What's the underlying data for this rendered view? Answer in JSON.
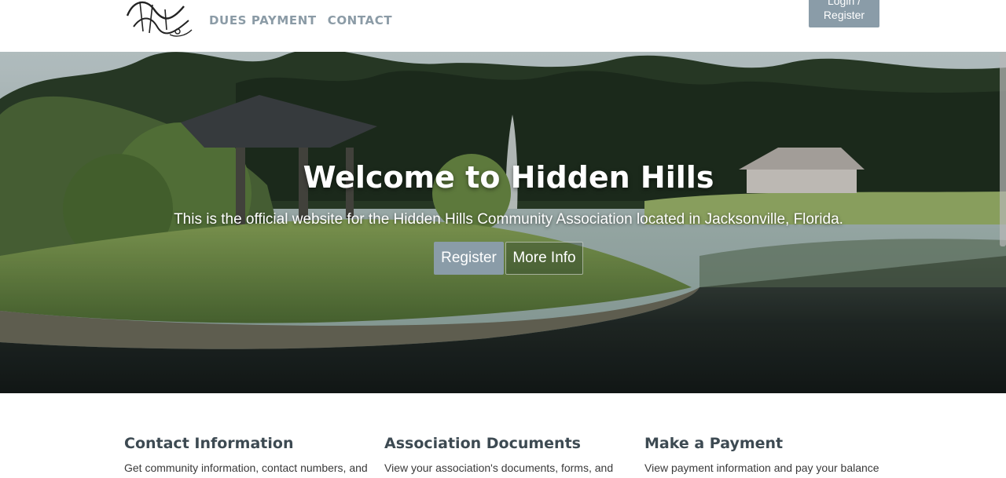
{
  "header": {
    "logo_alt": "Hidden Hills",
    "nav": [
      "DUES PAYMENT",
      "CONTACT"
    ],
    "login": {
      "line1": "Login /",
      "line2": "Register"
    }
  },
  "hero": {
    "title": "Welcome to Hidden Hills",
    "subtitle": "This is the official website for the Hidden Hills Community Association located in Jacksonville, Florida.",
    "register_label": "Register",
    "more_label": "More Info"
  },
  "features": [
    {
      "title": "Contact Information",
      "text": "Get community information, contact numbers, and"
    },
    {
      "title": "Association Documents",
      "text": "View your association's documents, forms, and"
    },
    {
      "title": "Make a Payment",
      "text": "View payment information and pay your balance"
    }
  ],
  "colors": {
    "accent": "#8a9ca8",
    "nav": "#8b9ba6",
    "heading": "#3d4a52"
  }
}
